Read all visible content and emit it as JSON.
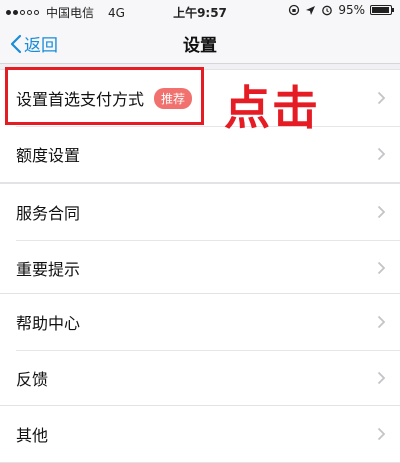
{
  "status_bar": {
    "carrier": "中国电信",
    "network": "4G",
    "time": "上午9:57",
    "battery": "95%",
    "battery_level": 0.95
  },
  "nav": {
    "back_label": "返回",
    "title": "设置"
  },
  "groups": [
    {
      "items": [
        {
          "label": "设置首选支付方式",
          "badge": "推荐"
        },
        {
          "label": "额度设置"
        }
      ]
    },
    {
      "items": [
        {
          "label": "服务合同"
        },
        {
          "label": "重要提示"
        }
      ]
    },
    {
      "items": [
        {
          "label": "帮助中心"
        },
        {
          "label": "反馈"
        }
      ]
    },
    {
      "items": [
        {
          "label": "其他"
        }
      ]
    }
  ],
  "annotation": {
    "text": "点击",
    "color": "#e51c23"
  },
  "colors": {
    "accent": "#1a8cd8",
    "badge": "#f0716d",
    "background": "#efeff4"
  }
}
